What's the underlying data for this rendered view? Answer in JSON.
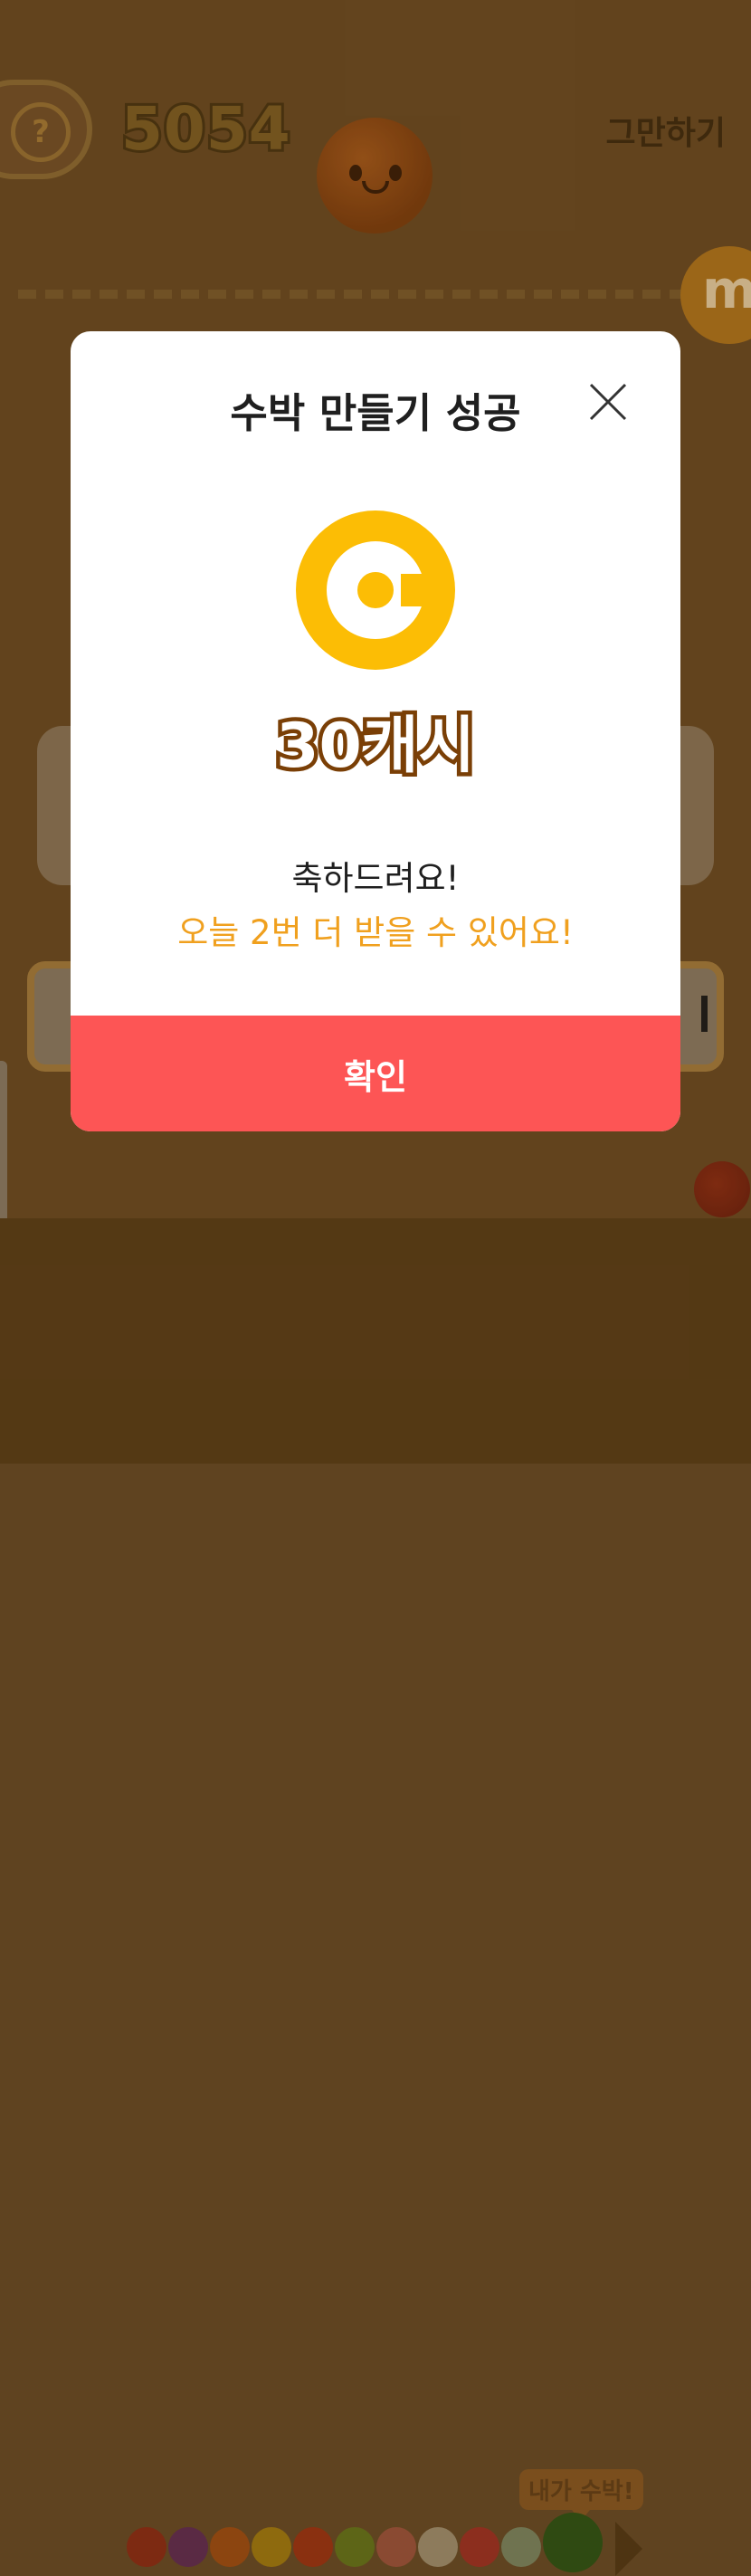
{
  "game": {
    "score": "5054",
    "quit_label": "그만하기",
    "help_label": "?",
    "side_badge_label": "m",
    "tip_label": "내가 수박!",
    "fruit_colors": [
      "#7d2a12",
      "#5a2a44",
      "#8c4510",
      "#8e6a0e",
      "#8a3010",
      "#5d6517",
      "#8a4a32",
      "#8d7b5c",
      "#8c2e1e",
      "#6f7350",
      "#2f4a12"
    ]
  },
  "modal": {
    "title": "수박 만들기 성공",
    "reward_text": "30캐시",
    "message_main": "축하드려요!",
    "message_sub": "오늘 2번 더 받을 수 있어요!",
    "confirm_label": "확인",
    "colors": {
      "confirm_bg": "#fd5555",
      "coin": "#fcbd05",
      "sub_text": "#f0a01e",
      "reward_outline": "#7a3f06"
    },
    "icons": {
      "close": "close-icon",
      "coin": "cash-coin-icon"
    }
  }
}
